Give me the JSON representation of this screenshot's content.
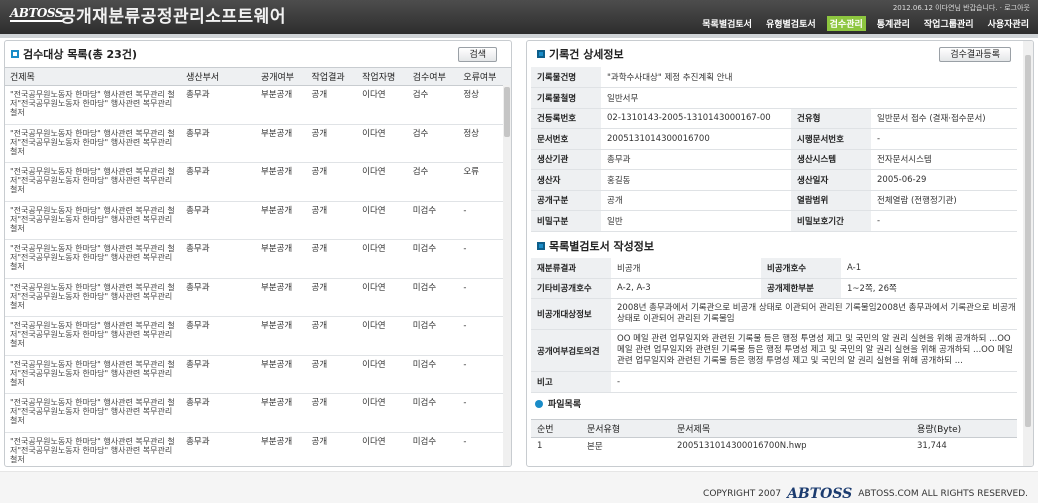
{
  "header": {
    "logo": "ABTOSS",
    "app_title": "공개재분류공정관리소프트웨어",
    "user_info": "2012.06.12 이다연님 반갑습니다. · 로그아웃",
    "nav": [
      "목록별검토서",
      "유형별검토서",
      "검수관리",
      "통계관리",
      "작업그룹관리",
      "사용자관리"
    ],
    "active_nav": "검수관리"
  },
  "left_panel": {
    "title": "검수대상 목록(총 23건)",
    "search_button": "검색",
    "columns": [
      "건제목",
      "생산부서",
      "공개여부",
      "작업결과",
      "작업자명",
      "검수여부",
      "오류여부"
    ],
    "rows": [
      {
        "title": "\"전국공무원노동자 한마당\" 행사관련 복무관리 철저\"전국공무원노동자 한마당\" 행사관련 복무관리 철저",
        "dept": "총무과",
        "open": "부분공개",
        "result": "공개",
        "worker": "이다연",
        "review": "검수",
        "error": "정상"
      },
      {
        "title": "\"전국공무원노동자 한마당\" 행사관련 복무관리 철저\"전국공무원노동자 한마당\" 행사관련 복무관리 철저",
        "dept": "총무과",
        "open": "부분공개",
        "result": "공개",
        "worker": "이다연",
        "review": "검수",
        "error": "정상"
      },
      {
        "title": "\"전국공무원노동자 한마당\" 행사관련 복무관리 철저\"전국공무원노동자 한마당\" 행사관련 복무관리 철저",
        "dept": "총무과",
        "open": "부분공개",
        "result": "공개",
        "worker": "이다연",
        "review": "검수",
        "error": "오류"
      },
      {
        "title": "\"전국공무원노동자 한마당\" 행사관련 복무관리 철저\"전국공무원노동자 한마당\" 행사관련 복무관리 철저",
        "dept": "총무과",
        "open": "부분공개",
        "result": "공개",
        "worker": "이다연",
        "review": "미검수",
        "error": "-"
      },
      {
        "title": "\"전국공무원노동자 한마당\" 행사관련 복무관리 철저\"전국공무원노동자 한마당\" 행사관련 복무관리 철저",
        "dept": "총무과",
        "open": "부분공개",
        "result": "공개",
        "worker": "이다연",
        "review": "미검수",
        "error": "-"
      },
      {
        "title": "\"전국공무원노동자 한마당\" 행사관련 복무관리 철저\"전국공무원노동자 한마당\" 행사관련 복무관리 철저",
        "dept": "총무과",
        "open": "부분공개",
        "result": "공개",
        "worker": "이다연",
        "review": "미검수",
        "error": "-"
      },
      {
        "title": "\"전국공무원노동자 한마당\" 행사관련 복무관리 철저\"전국공무원노동자 한마당\" 행사관련 복무관리 철저",
        "dept": "총무과",
        "open": "부분공개",
        "result": "공개",
        "worker": "이다연",
        "review": "미검수",
        "error": "-"
      },
      {
        "title": "\"전국공무원노동자 한마당\" 행사관련 복무관리 철저\"전국공무원노동자 한마당\" 행사관련 복무관리 철저",
        "dept": "총무과",
        "open": "부분공개",
        "result": "공개",
        "worker": "이다연",
        "review": "미검수",
        "error": "-"
      },
      {
        "title": "\"전국공무원노동자 한마당\" 행사관련 복무관리 철저\"전국공무원노동자 한마당\" 행사관련 복무관리 철저",
        "dept": "총무과",
        "open": "부분공개",
        "result": "공개",
        "worker": "이다연",
        "review": "미검수",
        "error": "-"
      },
      {
        "title": "\"전국공무원노동자 한마당\" 행사관련 복무관리 철저\"전국공무원노동자 한마당\" 행사관련 복무관리 철저",
        "dept": "총무과",
        "open": "부분공개",
        "result": "공개",
        "worker": "이다연",
        "review": "미검수",
        "error": "-"
      }
    ]
  },
  "right_panel": {
    "title": "기록건 상세정보",
    "register_button": "검수결과등록",
    "detail": {
      "record_title_label": "기록물건명",
      "record_title": "\"과학수사대상\" 제정 추진계획 안내",
      "record_form_label": "기록물철명",
      "record_form": "일반서무",
      "reg_no_label": "건등록번호",
      "reg_no": "02-1310143-2005-1310143000167-00",
      "type_label": "건유형",
      "type": "일반문서 접수 (결재·접수문서)",
      "doc_no_label": "문서번호",
      "doc_no": "2005131014300016700",
      "exec_no_label": "시행문서번호",
      "exec_no": "-",
      "org_label": "생산기관",
      "org": "총무과",
      "system_label": "생산시스템",
      "system": "전자문서시스템",
      "producer_label": "생산자",
      "producer": "홍길동",
      "date_label": "생산일자",
      "date": "2005-06-29",
      "public_label": "공개구분",
      "public": "공개",
      "access_label": "열람범위",
      "access": "전체열람 (전행정기관)",
      "secret_label": "비밀구분",
      "secret": "일반",
      "secret_period_label": "비밀보호기간",
      "secret_period": "-"
    },
    "review_section_title": "목록별검토서 작성정보",
    "review": {
      "result_label": "재분류결과",
      "result": "비공개",
      "non_public_no_label": "비공개호수",
      "non_public_no": "A-1",
      "other_no_label": "기타비공개호수",
      "other_no": "A-2, A-3",
      "limit_label": "공개제한부분",
      "limit": "1~2쪽, 26쪽",
      "reason_label": "비공개대상정보",
      "reason": "2008년 총무과에서 기록관으로 비공개 상태로 이관되어 관리된 기록물임2008년 총무과에서 기록관으로 비공개 상태로 이관되어 관리된 기록물임",
      "opinion_label": "공개여부검토의견",
      "opinion": "OO 메일 관련 업무일지와 관련된 기록물 등은 행정 투명성 제고 및 국민의 알 권리 실현을 위해 공개하되 ...OO 메일 관련 업무일지와 관련된 기록물 등은 행정 투명성 제고 및 국민의 알 권리 실현을 위해 공개하되 ...OO 메일 관련 업무일지와 관련된 기록물 등은 행정 투명성 제고 및 국민의 알 권리 실현을 위해 공개하되 ...",
      "note_label": "비고",
      "note": "-"
    },
    "files": {
      "title": "파일목록",
      "columns": [
        "순번",
        "문서유형",
        "문서제목",
        "용량(Byte)"
      ],
      "rows": [
        {
          "no": "1",
          "type": "본문",
          "name": "2005131014300016700N.hwp",
          "size": "31,744"
        }
      ]
    }
  },
  "footer": {
    "copyright": "COPYRIGHT 2007",
    "brand": "ABTOSS",
    "rights": "ABTOSS.COM ALL RIGHTS RESERVED."
  },
  "colors": {
    "accent_blue": "#1a8cc8",
    "active_nav": "#8dc63f",
    "error_red": "#d21a1a",
    "header_dark": "#3a3a3a"
  }
}
